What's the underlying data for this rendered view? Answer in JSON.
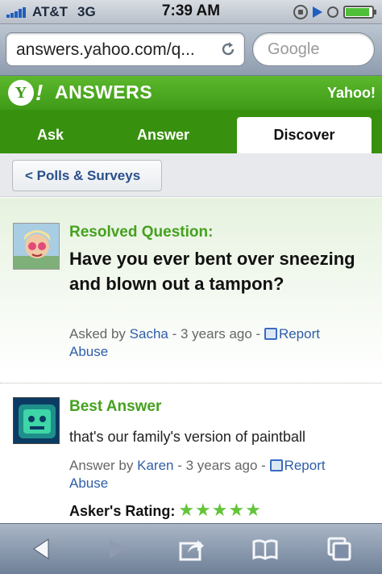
{
  "status_bar": {
    "carrier": "AT&T",
    "network": "3G",
    "time": "7:39 AM",
    "icons": [
      "signal-icon",
      "rotation-lock-icon",
      "play-icon",
      "alarm-icon",
      "battery-icon"
    ],
    "battery_level": 0.9
  },
  "url_bar": {
    "url": "answers.yahoo.com/q...",
    "search_placeholder": "Google"
  },
  "header": {
    "logo_letter": "Y",
    "logo_bang": "!",
    "title": "ANSWERS",
    "right_link": "Yahoo!",
    "brand_color": "#3f9a18"
  },
  "tabs": [
    {
      "label": "Ask",
      "active": false
    },
    {
      "label": "Answer",
      "active": false
    },
    {
      "label": "Discover",
      "active": true
    }
  ],
  "breadcrumb": {
    "label": "< Polls & Surveys"
  },
  "question": {
    "status": "Resolved Question:",
    "title": "Have you ever bent over sneezing and blown out a tampon?",
    "asked_by_prefix": "Asked by",
    "author": "Sacha",
    "age": "- 3 years ago -",
    "report_label": "Report",
    "report_label2": "Abuse"
  },
  "best_answer": {
    "heading": "Best Answer",
    "text": "that's our family's version of paintball",
    "answer_by_prefix": "Answer by",
    "author": "Karen",
    "age": "- 3 years ago -",
    "report_label": "Report",
    "report_label2": "Abuse",
    "rating_label": "Asker's Rating:",
    "stars": "★★★★★",
    "rating": 5,
    "rating_max": 5,
    "star_color": "#63c53a"
  },
  "toolbar": {
    "buttons": [
      "back-icon",
      "forward-icon",
      "share-icon",
      "bookmarks-icon",
      "tabs-icon"
    ]
  }
}
